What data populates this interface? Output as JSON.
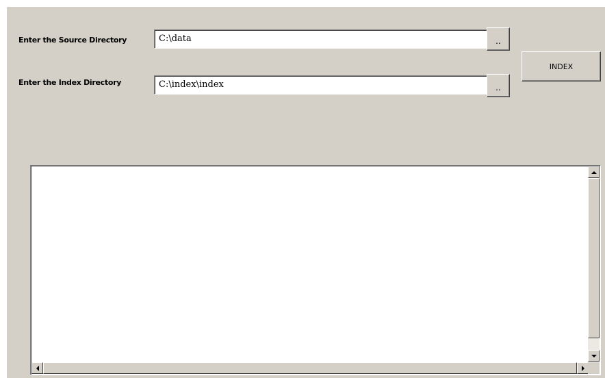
{
  "form": {
    "source_label": "Enter the Source Directory",
    "source_value": "C:\\data",
    "index_label": "Enter the Index Directory",
    "index_value": "C:\\index\\index",
    "browse_label": "..",
    "index_button_label": "INDEX"
  },
  "output": {
    "text": ""
  },
  "colors": {
    "window_bg": "#d4d0c8",
    "field_bg": "#ffffff",
    "scroll_track": "#ebe9e2"
  },
  "icons": {
    "scroll_up": "scroll-up-arrow-icon",
    "scroll_down": "scroll-down-arrow-icon",
    "scroll_left": "scroll-left-arrow-icon",
    "scroll_right": "scroll-right-arrow-icon"
  }
}
